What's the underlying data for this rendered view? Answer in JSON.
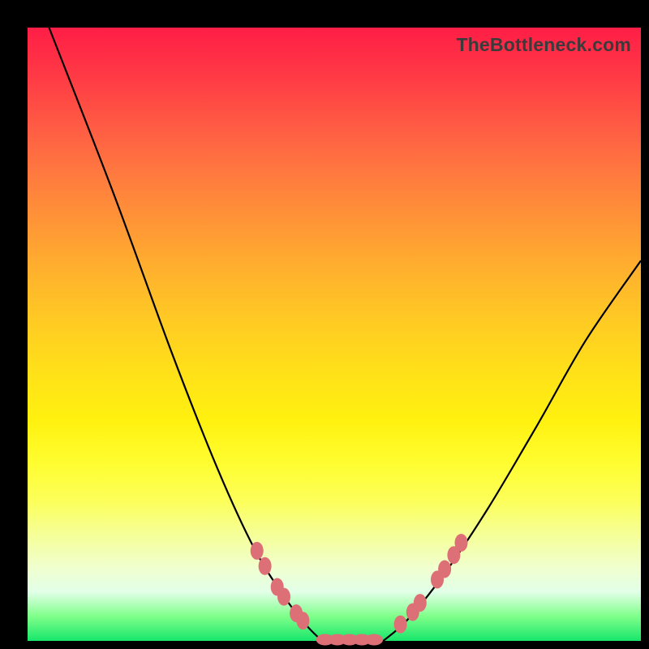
{
  "credit": "TheBottleneck.com",
  "chart_data": {
    "type": "line",
    "title": "",
    "xlabel": "",
    "ylabel": "",
    "xlim": [
      0,
      1
    ],
    "ylim": [
      0,
      1
    ],
    "series": [
      {
        "name": "left-branch",
        "x": [
          0.035,
          0.14,
          0.235,
          0.31,
          0.37,
          0.42,
          0.455,
          0.48
        ],
        "y": [
          1.0,
          0.73,
          0.47,
          0.28,
          0.15,
          0.07,
          0.025,
          0.0
        ]
      },
      {
        "name": "flat",
        "x": [
          0.48,
          0.58
        ],
        "y": [
          0.0,
          0.0
        ]
      },
      {
        "name": "right-branch",
        "x": [
          0.58,
          0.62,
          0.68,
          0.75,
          0.83,
          0.91,
          1.0
        ],
        "y": [
          0.0,
          0.035,
          0.11,
          0.215,
          0.35,
          0.49,
          0.62
        ]
      }
    ],
    "markers_left": [
      [
        0.374,
        0.147
      ],
      [
        0.387,
        0.122
      ],
      [
        0.407,
        0.088
      ],
      [
        0.418,
        0.072
      ],
      [
        0.438,
        0.045
      ],
      [
        0.449,
        0.033
      ]
    ],
    "markers_right": [
      [
        0.608,
        0.027
      ],
      [
        0.628,
        0.047
      ],
      [
        0.64,
        0.062
      ],
      [
        0.668,
        0.1
      ],
      [
        0.68,
        0.117
      ],
      [
        0.695,
        0.14
      ],
      [
        0.707,
        0.16
      ]
    ],
    "flat_blobs": [
      0.485,
      0.505,
      0.525,
      0.545,
      0.565
    ],
    "colors": {
      "bead": "#dd7076",
      "curve": "#000000"
    }
  }
}
